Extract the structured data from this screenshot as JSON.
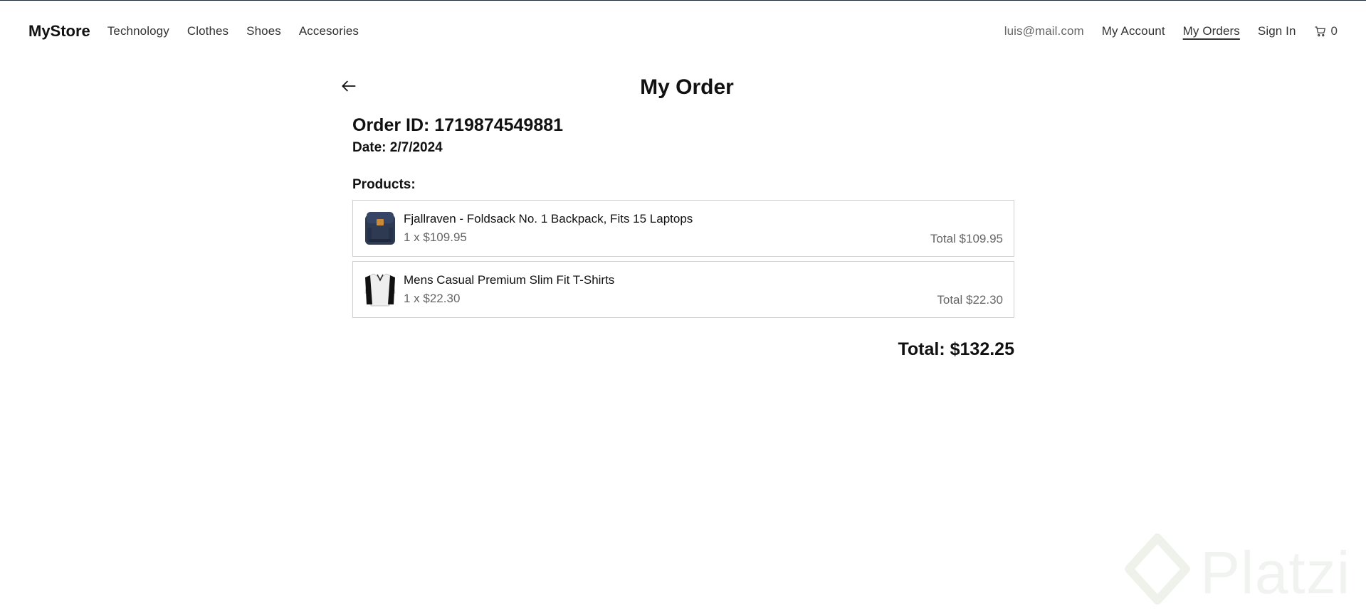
{
  "navbar": {
    "brand": "MyStore",
    "categories": [
      "Technology",
      "Clothes",
      "Shoes",
      "Accesories"
    ],
    "email": "luis@mail.com",
    "my_account": "My Account",
    "my_orders": "My Orders",
    "sign_in": "Sign In",
    "cart_count": "0"
  },
  "page": {
    "title": "My Order",
    "order_id": "Order ID: 1719874549881",
    "date": "Date: 2/7/2024",
    "products_label": "Products:",
    "grand_total": "Total: $132.25"
  },
  "products": [
    {
      "name": "Fjallraven - Foldsack No. 1 Backpack, Fits 15 Laptops",
      "qty_price": "1 x $109.95",
      "total": "Total $109.95",
      "icon": "backpack-thumbnail"
    },
    {
      "name": "Mens Casual Premium Slim Fit T-Shirts",
      "qty_price": "1 x $22.30",
      "total": "Total $22.30",
      "icon": "tshirt-thumbnail"
    }
  ],
  "watermark": {
    "text": "Platzi"
  },
  "colors": {
    "accent": "#111111",
    "muted": "#666666",
    "border": "#cfcfcf",
    "watermark": "#e9ece9"
  }
}
